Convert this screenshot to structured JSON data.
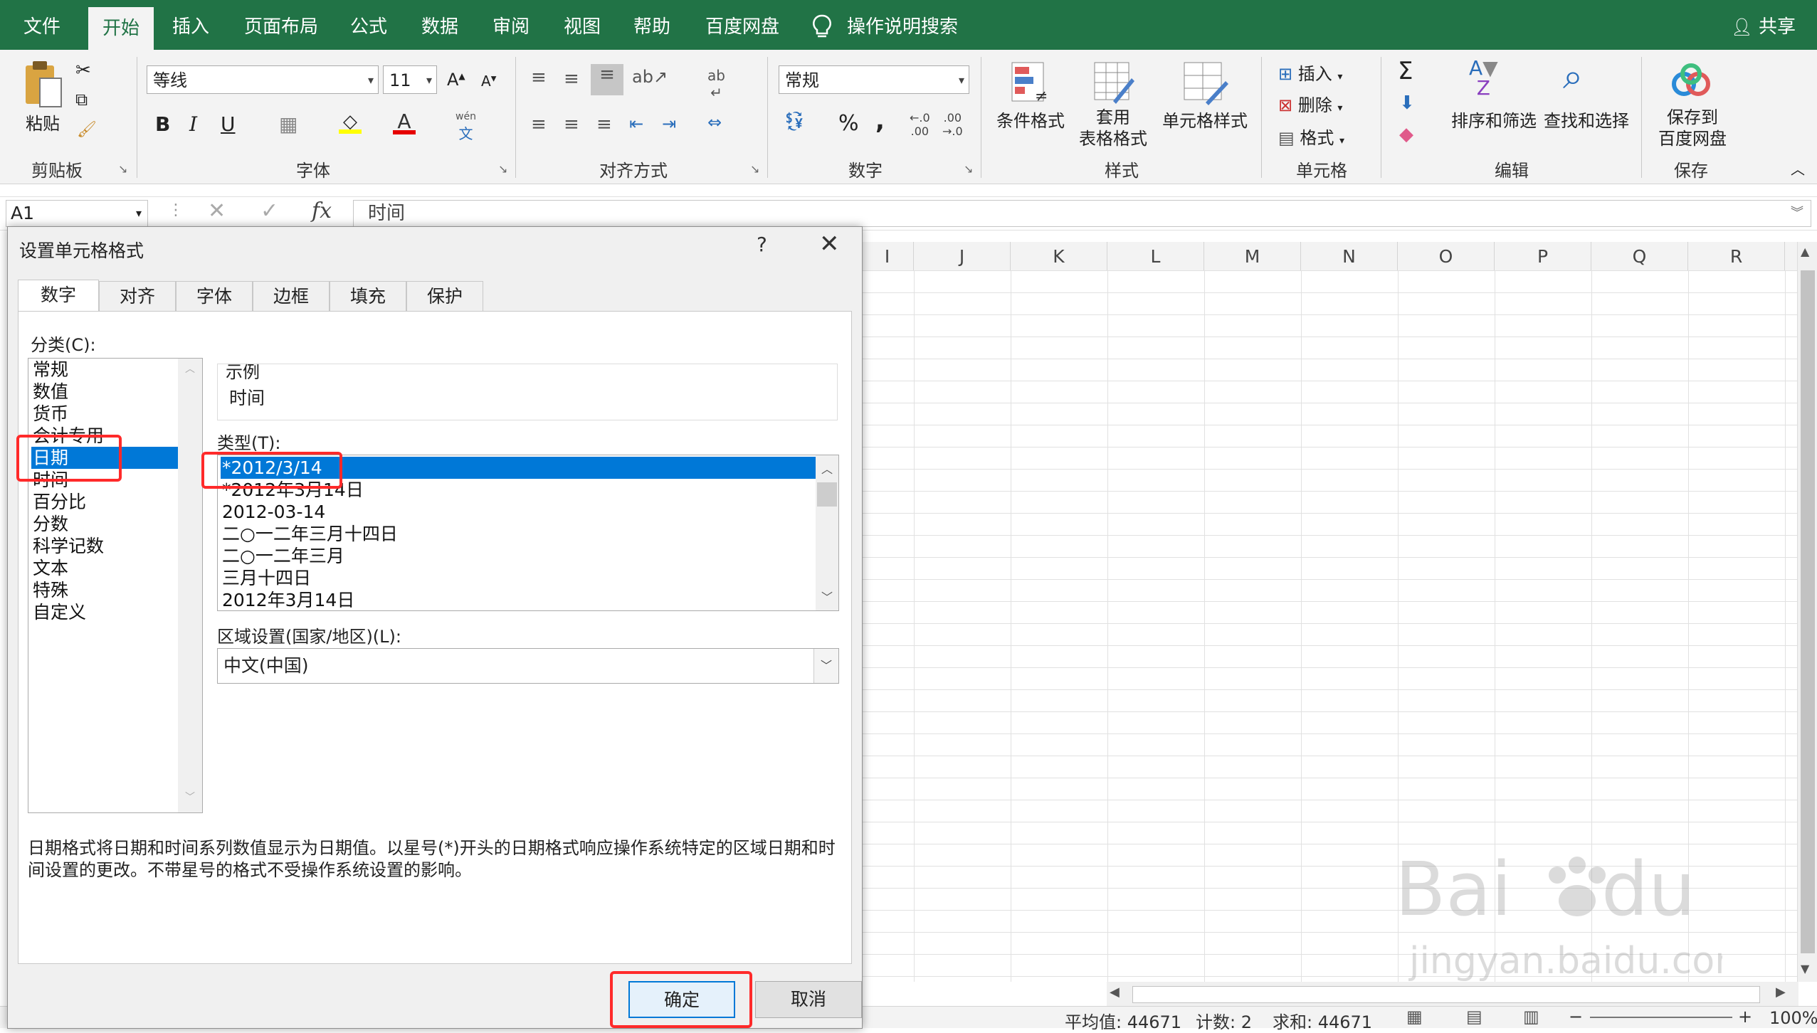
{
  "menu": {
    "tabs": [
      {
        "label": "文件"
      },
      {
        "label": "开始"
      },
      {
        "label": "插入"
      },
      {
        "label": "页面布局"
      },
      {
        "label": "公式"
      },
      {
        "label": "数据"
      },
      {
        "label": "审阅"
      },
      {
        "label": "视图"
      },
      {
        "label": "帮助"
      },
      {
        "label": "百度网盘"
      }
    ],
    "search_label": "操作说明搜索",
    "share_label": "共享",
    "accent_color": "#217346"
  },
  "ribbon": {
    "clipboard": {
      "paste_label": "粘贴",
      "group_label": "剪贴板"
    },
    "font": {
      "font_name": "等线",
      "font_size": "11",
      "group_label": "字体",
      "bold": "B",
      "italic": "I",
      "underline": "U",
      "phonetic": "wén"
    },
    "alignment": {
      "group_label": "对齐方式"
    },
    "number": {
      "format": "常规",
      "group_label": "数字",
      "percent": "%",
      "comma": ","
    },
    "styles": {
      "conditional": "条件格式",
      "table_line1": "套用",
      "table_line2": "表格格式",
      "cell_styles": "单元格样式",
      "group_label": "样式"
    },
    "cells": {
      "insert": "插入",
      "delete": "删除",
      "format": "格式",
      "group_label": "单元格"
    },
    "editing": {
      "sort_filter": "排序和筛选",
      "find_select": "查找和选择",
      "group_label": "编辑"
    },
    "save": {
      "save_line1": "保存到",
      "save_line2": "百度网盘",
      "group_label": "保存"
    }
  },
  "formula_bar": {
    "name_box": "A1",
    "formula": "时间",
    "fx": "fx"
  },
  "sheet": {
    "columns": [
      "I",
      "J",
      "K",
      "L",
      "M",
      "N",
      "O",
      "P",
      "Q",
      "R"
    ]
  },
  "dialog": {
    "title": "设置单元格格式",
    "help": "?",
    "tabs": [
      {
        "label": "数字"
      },
      {
        "label": "对齐"
      },
      {
        "label": "字体"
      },
      {
        "label": "边框"
      },
      {
        "label": "填充"
      },
      {
        "label": "保护"
      }
    ],
    "category_label": "分类(C):",
    "categories": [
      {
        "label": "常规"
      },
      {
        "label": "数值"
      },
      {
        "label": "货币"
      },
      {
        "label": "会计专用"
      },
      {
        "label": "日期"
      },
      {
        "label": "时间"
      },
      {
        "label": "百分比"
      },
      {
        "label": "分数"
      },
      {
        "label": "科学记数"
      },
      {
        "label": "文本"
      },
      {
        "label": "特殊"
      },
      {
        "label": "自定义"
      }
    ],
    "selected_category": "日期",
    "sample_label": "示例",
    "sample_value": "时间",
    "type_label": "类型(T):",
    "types": [
      {
        "label": "*2012/3/14"
      },
      {
        "label": "*2012年3月14日"
      },
      {
        "label": "2012-03-14"
      },
      {
        "label": "二○一二年三月十四日"
      },
      {
        "label": "二○一二年三月"
      },
      {
        "label": "三月十四日"
      },
      {
        "label": "2012年3月14日"
      }
    ],
    "locale_label": "区域设置(国家/地区)(L):",
    "locale_value": "中文(中国)",
    "description": "日期格式将日期和时间系列数值显示为日期值。以星号(*)开头的日期格式响应操作系统特定的区域日期和时间设置的更改。不带星号的格式不受操作系统设置的影响。",
    "ok_label": "确定",
    "cancel_label": "取消",
    "highlight_color": "#ff2a2a",
    "selection_color": "#0078d7"
  },
  "status_bar": {
    "average": "平均值: 44671",
    "count": "计数: 2",
    "sum": "求和: 44671",
    "zoom": "100%"
  },
  "watermark": {
    "brand": "Baidu经验",
    "url": "jingyan.baidu.com"
  }
}
